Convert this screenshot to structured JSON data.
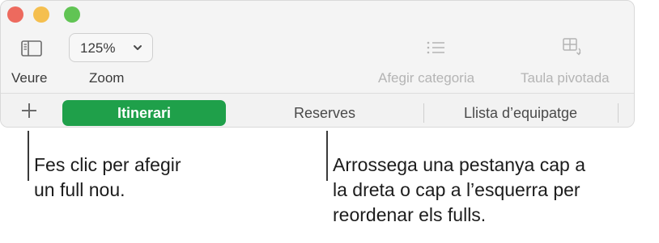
{
  "toolbar": {
    "view_label": "Veure",
    "zoom_value": "125%",
    "zoom_label": "Zoom",
    "add_category_label": "Afegir categoria",
    "pivot_table_label": "Taula pivotada"
  },
  "sheets": {
    "tabs": [
      "Itinerari",
      "Reserves",
      "Llista d’equipatge"
    ],
    "active_index": 0,
    "active_color": "#1fa04a"
  },
  "callouts": {
    "add_sheet": [
      "Fes clic per afegir",
      "un full nou."
    ],
    "reorder": [
      "Arrossega una pestanya cap a",
      "la dreta o cap a l’esquerra per",
      "reordenar els fulls."
    ]
  },
  "icons": [
    "sidebar-icon",
    "chevron-down-icon",
    "list-icon",
    "pivot-table-icon",
    "plus-icon"
  ]
}
